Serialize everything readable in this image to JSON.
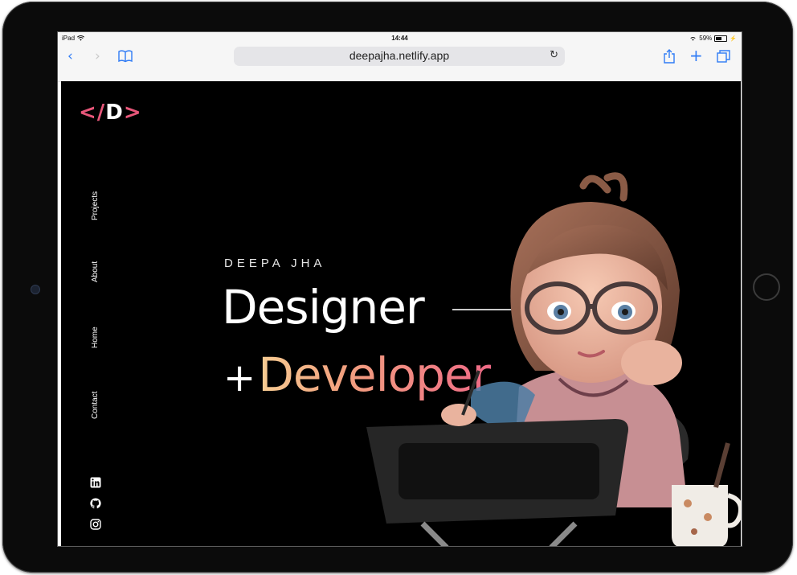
{
  "status_bar": {
    "device": "iPad",
    "time": "14:44",
    "battery": "59%"
  },
  "browser": {
    "url": "deepajha.netlify.app",
    "icons": [
      "back-icon",
      "forward-icon",
      "bookmarks-icon",
      "reload-icon",
      "share-icon",
      "new-tab-icon",
      "tabs-icon"
    ]
  },
  "site": {
    "logo": {
      "left": "<",
      "slash": "/",
      "letter": "D",
      "right": ">"
    },
    "nav": [
      {
        "label": "Projects"
      },
      {
        "label": "About"
      },
      {
        "label": "Home"
      },
      {
        "label": "Contact"
      }
    ],
    "social": [
      "linkedin-icon",
      "github-icon",
      "instagram-icon"
    ],
    "hero": {
      "name": "DEEPA JHA",
      "title": "Designer",
      "plus": "+",
      "subtitle": "Developer"
    },
    "colors": {
      "accent": "#e8577a",
      "gradient_start": "#f7cd93",
      "gradient_end": "#ef6a86",
      "background": "#000000"
    }
  }
}
